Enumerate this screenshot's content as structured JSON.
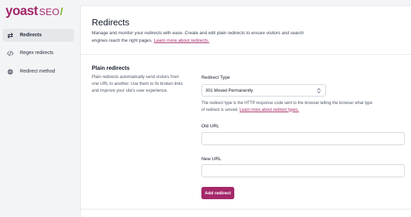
{
  "brand": {
    "wordmark": "yoast",
    "product": "SEO",
    "slash": "/",
    "color_primary": "#a4286a",
    "color_accent": "#77b227"
  },
  "sidebar": {
    "items": [
      {
        "label": "Redirects",
        "icon": "arrows-swap-icon",
        "active": true
      },
      {
        "label": "Regex redirects",
        "icon": "code-brackets-icon",
        "active": false
      },
      {
        "label": "Redirect method",
        "icon": "gear-icon",
        "active": false
      }
    ]
  },
  "header": {
    "title": "Redirects",
    "description": "Manage and monitor your redirects with ease. Create and edit plain redirects to ensure visitors and search engines reach the right pages.",
    "learn_more": "Learn more about redirects."
  },
  "section": {
    "title": "Plain redirects",
    "description": "Plain redirects automatically send visitors from one URL to another. Use them to fix broken links and improve your site's user experience."
  },
  "form": {
    "redirect_type_label": "Redirect Type",
    "redirect_type_value": "301 Moved Permanently",
    "redirect_type_hint": "The redirect type is the HTTP response code sent to the browser telling the browser what type of redirect is served.",
    "redirect_type_link": "Learn more about redirect types.",
    "old_url_label": "Old URL",
    "old_url_value": "",
    "new_url_label": "New URL",
    "new_url_value": "",
    "submit_label": "Add redirect"
  }
}
